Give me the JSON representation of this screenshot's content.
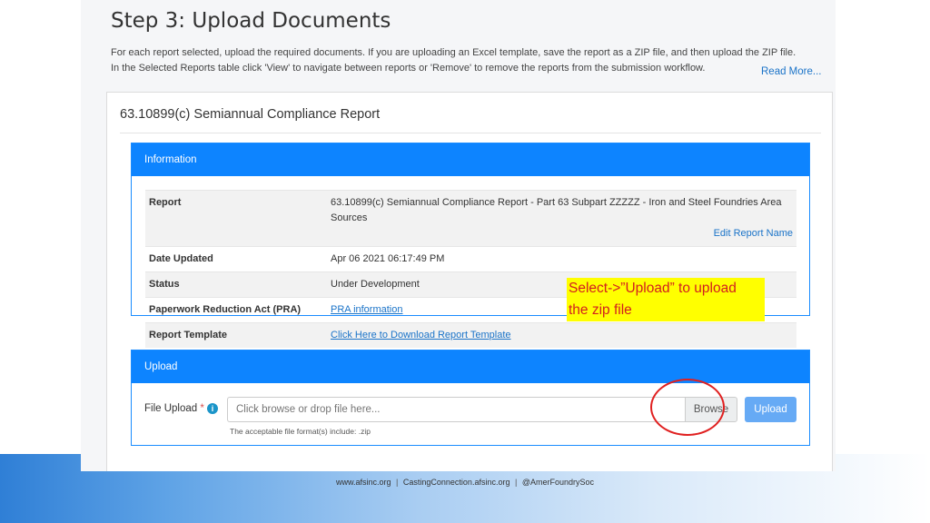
{
  "step": {
    "title": "Step 3: Upload Documents",
    "description_line1": "For each report selected, upload the required documents. If you are uploading an Excel template, save the report as a ZIP file, and then upload the ZIP file.",
    "description_line2": "In the Selected Reports table click 'View' to navigate between reports or 'Remove' to remove the reports from the submission workflow.",
    "read_more": "Read More..."
  },
  "card": {
    "title": "63.10899(c) Semiannual Compliance Report"
  },
  "information": {
    "header": "Information",
    "rows": {
      "report_key": "Report",
      "report_value": "63.10899(c) Semiannual Compliance Report - Part 63 Subpart ZZZZZ - Iron and Steel Foundries Area Sources",
      "edit_report_name": "Edit Report Name",
      "date_key": "Date Updated",
      "date_value": "Apr 06 2021 06:17:49 PM",
      "status_key": "Status",
      "status_value": "Under Development",
      "pra_key": "Paperwork Reduction Act (PRA)",
      "pra_value": "PRA information",
      "template_key": "Report Template",
      "template_value": "Click Here to Download Report Template"
    }
  },
  "callout": {
    "line1": "Select->”Upload” to upload",
    "line2": "the zip file"
  },
  "upload": {
    "header": "Upload",
    "label": "File Upload",
    "required_mark": "*",
    "info_glyph": "i",
    "placeholder": "Click browse or drop file here...",
    "browse_label": "Browse",
    "upload_label": "Upload",
    "accept_note": "The acceptable file format(s) include: .zip"
  },
  "footer": {
    "site": "www.afsinc.org",
    "casting": "CastingConnection.afsinc.org",
    "social": "@AmerFoundrySoc",
    "separator": "|"
  },
  "colors": {
    "primary_blue": "#0d84ff",
    "callout_bg": "#ffff00",
    "callout_text": "#d21f1f",
    "highlight_circle": "#e02020"
  }
}
